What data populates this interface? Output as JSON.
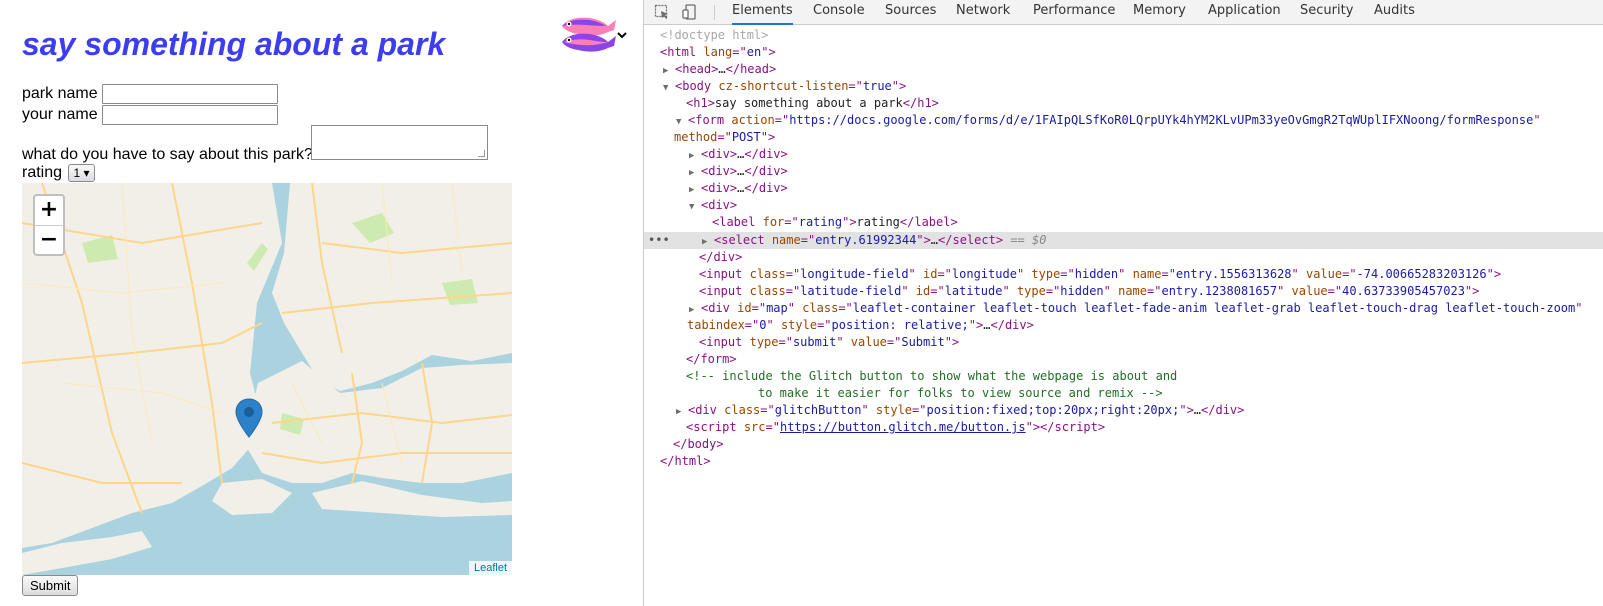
{
  "page": {
    "heading": "say something about a park",
    "fields": {
      "park_name_label": "park name",
      "park_name_value": "",
      "your_name_label": "your name",
      "your_name_value": "",
      "comment_label": "what do you have to say about this park?",
      "comment_value": "",
      "rating_label": "rating",
      "rating_value": "1"
    },
    "map": {
      "zoom_in": "+",
      "zoom_out": "−",
      "attribution": "Leaflet",
      "water_color": "#aad3df",
      "land_color": "#f2efe9",
      "marker_color": "#2b82cb"
    },
    "submit_label": "Submit"
  },
  "devtools": {
    "tabs": [
      "Elements",
      "Console",
      "Sources",
      "Network",
      "Performance",
      "Memory",
      "Application",
      "Security",
      "Audits"
    ],
    "active_tab": "Elements",
    "icons": [
      "inspect-element-icon",
      "device-toolbar-icon"
    ],
    "dom": {
      "doctype": "<!doctype html>",
      "html_open": "html",
      "lang_attr": "lang",
      "lang_val": "en",
      "head": "head",
      "body": "body",
      "body_attr": "cz-shortcut-listen",
      "body_val": "true",
      "h1": "h1",
      "h1_text": "say something about a park",
      "form": "form",
      "action_attr": "action",
      "action_val": "https://docs.google.com/forms/d/e/1FAIpQLSfKoR0LQrpUYk4hYM2KLvUPm33yeOvGmgR2TqWUplIFXNoong/formResponse",
      "method_attr": "method",
      "method_val": "POST",
      "div": "div",
      "label": "label",
      "for_attr": "for",
      "for_val": "rating",
      "label_text": "rating",
      "select": "select",
      "name_attr": "name",
      "select_name_val": "entry.61992344",
      "selected_marker": "== $0",
      "input": "input",
      "class_attr": "class",
      "id_attr": "id",
      "type_attr": "type",
      "value_attr": "value",
      "lng_class": "longitude-field",
      "lng_id": "longitude",
      "hidden": "hidden",
      "lng_name": "entry.1556313628",
      "lng_value": "-74.00665283203126",
      "lat_class": "latitude-field",
      "lat_id": "latitude",
      "lat_name": "entry.1238081657",
      "lat_value": "40.63733905457023",
      "map_id": "map",
      "map_class": "leaflet-container leaflet-touch leaflet-fade-anim leaflet-grab leaflet-touch-drag leaflet-touch-zoom",
      "tabindex_attr": "tabindex",
      "tabindex_val": "0",
      "style_attr": "style",
      "map_style": "position: relative;",
      "submit_type": "submit",
      "submit_value": "Submit",
      "comment_line1": "<!-- include the Glitch button to show what the webpage is about and",
      "comment_line2": "to make it easier for folks to view source and remix -->",
      "glitch_class": "glitchButton",
      "glitch_style": "position:fixed;top:20px;right:20px;",
      "script": "script",
      "src_attr": "src",
      "script_src": "https://button.glitch.me/button.js",
      "ellipsis": "…"
    }
  }
}
